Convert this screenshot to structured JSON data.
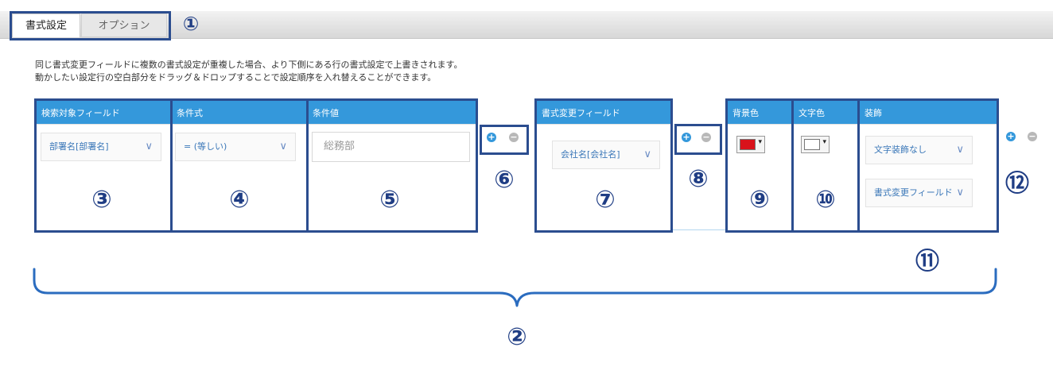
{
  "tabs": [
    "書式設定",
    "オプション"
  ],
  "description": [
    "同じ書式変更フィールドに複数の書式設定が重複した場合、より下側にある行の書式設定で上書きされます。",
    "動かしたい設定行の空白部分をドラッグ＆ドロップすることで設定順序を入れ替えることができます。"
  ],
  "columns": {
    "search_field": "検索対象フィールド",
    "condition": "条件式",
    "condition_value": "条件値",
    "format_field": "書式変更フィールド",
    "bg_color": "背景色",
    "text_color": "文字色",
    "decoration": "装飾"
  },
  "row": {
    "search_field_value": "部署名[部署名]",
    "condition_value": "= (等しい)",
    "input_value": "総務部",
    "format_field_value": "会社名[会社名]",
    "bg_color_value": "#d9121b",
    "text_color_value": "#ffffff",
    "decoration_value": "文字装飾なし",
    "decoration_field_value": "書式変更フィールド"
  },
  "icons": {
    "add": "plus-circle-icon",
    "remove": "minus-circle-icon",
    "dropdown": "chevron-down-icon",
    "color_arrow": "caret-down-icon"
  },
  "buttons": {
    "add_glyph": "+",
    "remove_glyph": "−",
    "chevron_glyph": "∨",
    "caret_glyph": "▾"
  },
  "callouts": [
    "①",
    "②",
    "③",
    "④",
    "⑤",
    "⑥",
    "⑦",
    "⑧",
    "⑨",
    "⑩",
    "⑪",
    "⑫"
  ],
  "colors": {
    "header": "#3498db",
    "callout": "#2b4d8f",
    "accent_text": "#3a77b8"
  }
}
